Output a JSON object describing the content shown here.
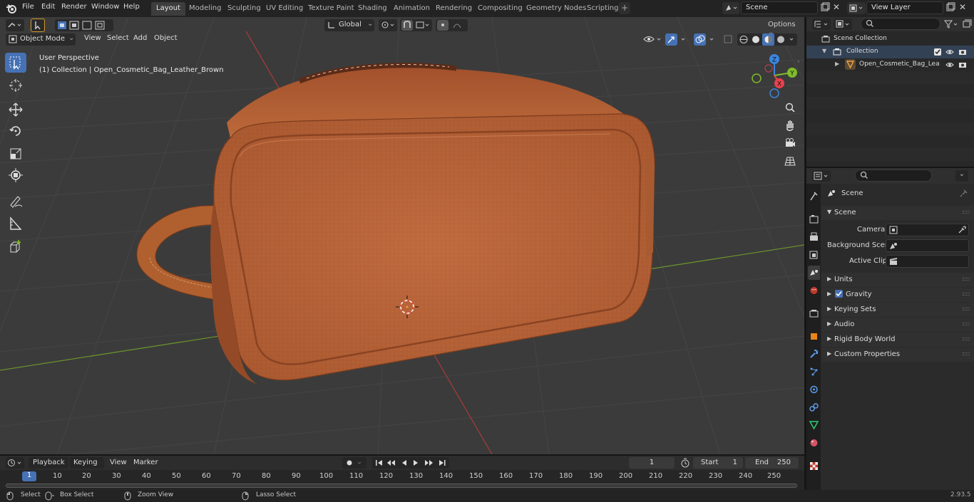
{
  "app": {
    "menus": [
      "File",
      "Edit",
      "Render",
      "Window",
      "Help"
    ],
    "workspaces": [
      "Layout",
      "Modeling",
      "Sculpting",
      "UV Editing",
      "Texture Paint",
      "Shading",
      "Animation",
      "Rendering",
      "Compositing",
      "Geometry Nodes",
      "Scripting"
    ],
    "active_workspace": "Layout",
    "scene_name": "Scene",
    "view_layer": "View Layer",
    "version": "2.93.5"
  },
  "viewport": {
    "mode": "Object Mode",
    "menus": [
      "View",
      "Select",
      "Add",
      "Object"
    ],
    "transform_orientation": "Global",
    "options_label": "Options",
    "perspective_label": "User Perspective",
    "collection_label": "(1) Collection | Open_Cosmetic_Bag_Leather_Brown",
    "gizmo_axes": {
      "x": "X",
      "y": "Y",
      "z": "Z"
    },
    "colors": {
      "x": "#e8424e",
      "y": "#7fbd2a",
      "z": "#3b86de",
      "selection": "#4672b5",
      "leather": "#b8653a"
    }
  },
  "outliner": {
    "rows": [
      {
        "label": "Scene Collection"
      },
      {
        "label": "Collection"
      },
      {
        "label": "Open_Cosmetic_Bag_Lea"
      }
    ]
  },
  "properties": {
    "context_title": "Scene",
    "panel_scene": "Scene",
    "fields": [
      {
        "label": "Camera"
      },
      {
        "label": "Background Scene"
      },
      {
        "label": "Active Clip"
      }
    ],
    "panels": [
      {
        "label": "Units",
        "checkbox": false
      },
      {
        "label": "Gravity",
        "checkbox": true
      },
      {
        "label": "Keying Sets",
        "checkbox": false
      },
      {
        "label": "Audio",
        "checkbox": false
      },
      {
        "label": "Rigid Body World",
        "checkbox": false
      },
      {
        "label": "Custom Properties",
        "checkbox": false
      }
    ]
  },
  "timeline": {
    "menus": [
      "Playback",
      "Keying",
      "View",
      "Marker"
    ],
    "current_frame": "1",
    "start_label": "Start",
    "start_value": "1",
    "end_label": "End",
    "end_value": "250",
    "ticks": [
      "1",
      "10",
      "20",
      "30",
      "40",
      "50",
      "60",
      "70",
      "80",
      "90",
      "100",
      "110",
      "120",
      "130",
      "140",
      "150",
      "160",
      "170",
      "180",
      "190",
      "200",
      "210",
      "220",
      "230",
      "240",
      "250"
    ]
  },
  "statusbar": {
    "items": [
      "Select",
      "Box Select",
      "Zoom View",
      "Lasso Select"
    ]
  }
}
